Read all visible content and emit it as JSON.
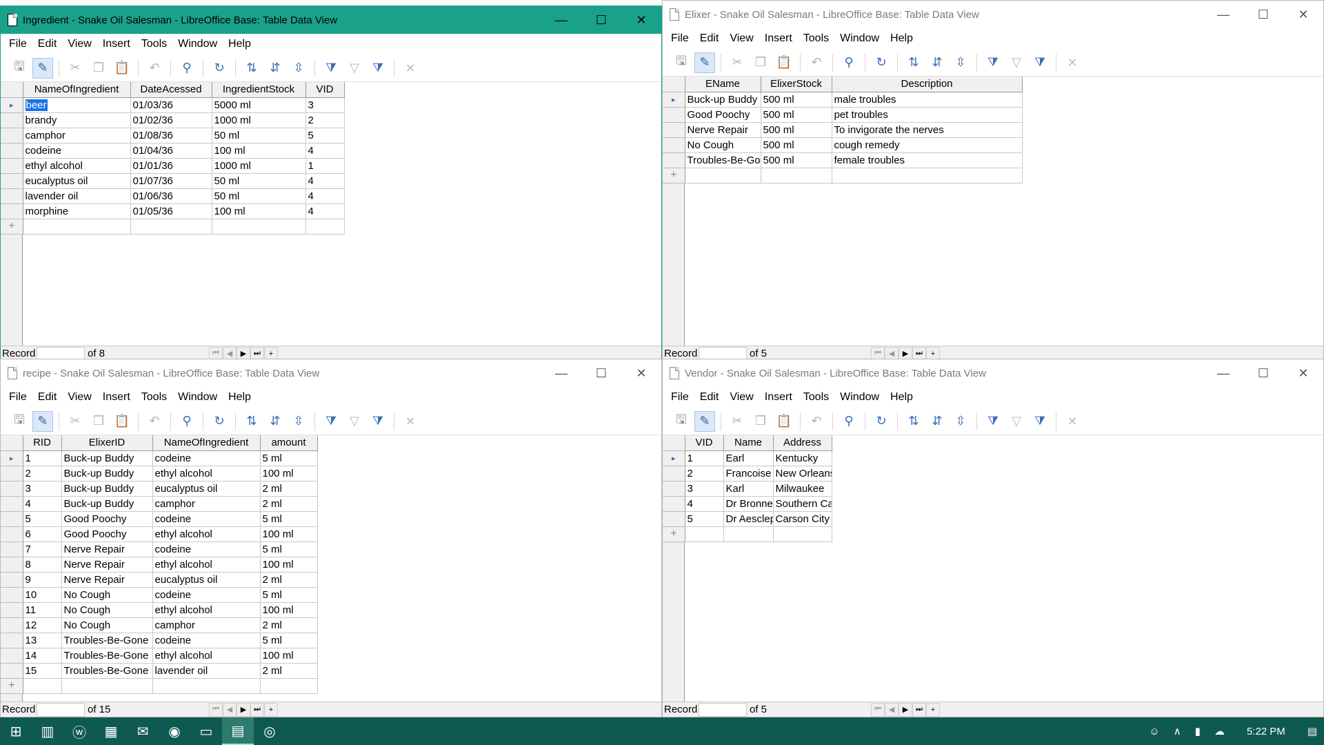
{
  "windows": {
    "ingredient": {
      "title": "Ingredient - Snake Oil Salesman - LibreOffice Base: Table Data View",
      "columns": [
        "NameOfIngredient",
        "DateAcessed",
        "IngredientStock",
        "VID"
      ],
      "rows": [
        [
          "beer",
          "01/03/36",
          "5000 ml",
          "3"
        ],
        [
          "brandy",
          "01/02/36",
          "1000 ml",
          "2"
        ],
        [
          "camphor",
          "01/08/36",
          "50 ml",
          "5"
        ],
        [
          "codeine",
          "01/04/36",
          "100 ml",
          "4"
        ],
        [
          "ethyl alcohol",
          "01/01/36",
          "1000 ml",
          "1"
        ],
        [
          "eucalyptus oil",
          "01/07/36",
          "50 ml",
          "4"
        ],
        [
          "lavender oil",
          "01/06/36",
          "50 ml",
          "4"
        ],
        [
          "morphine",
          "01/05/36",
          "100 ml",
          "4"
        ]
      ],
      "record_label": "Record",
      "record_of": "of 8"
    },
    "elixer": {
      "title": "Elixer - Snake Oil Salesman - LibreOffice Base: Table Data View",
      "columns": [
        "EName",
        "ElixerStock",
        "Description"
      ],
      "rows": [
        [
          "Buck-up Buddy",
          "500 ml",
          "male troubles"
        ],
        [
          "Good Poochy",
          "500 ml",
          "pet troubles"
        ],
        [
          "Nerve Repair",
          "500 ml",
          "To invigorate the nerves"
        ],
        [
          "No Cough",
          "500 ml",
          "cough remedy"
        ],
        [
          "Troubles-Be-Go",
          "500 ml",
          "female troubles"
        ]
      ],
      "record_label": "Record",
      "record_of": "of 5"
    },
    "recipe": {
      "title": "recipe - Snake Oil Salesman - LibreOffice Base: Table Data View",
      "columns": [
        "RID",
        "ElixerID",
        "NameOfIngredient",
        "amount"
      ],
      "rows": [
        [
          "1",
          "Buck-up Buddy",
          "codeine",
          "5 ml"
        ],
        [
          "2",
          "Buck-up Buddy",
          "ethyl alcohol",
          "100 ml"
        ],
        [
          "3",
          "Buck-up Buddy",
          "eucalyptus oil",
          "2 ml"
        ],
        [
          "4",
          "Buck-up Buddy",
          "camphor",
          "2 ml"
        ],
        [
          "5",
          "Good Poochy",
          "codeine",
          "5 ml"
        ],
        [
          "6",
          "Good Poochy",
          "ethyl alcohol",
          "100 ml"
        ],
        [
          "7",
          "Nerve Repair",
          "codeine",
          "5 ml"
        ],
        [
          "8",
          "Nerve Repair",
          "ethyl alcohol",
          "100 ml"
        ],
        [
          "9",
          "Nerve Repair",
          "eucalyptus oil",
          "2 ml"
        ],
        [
          "10",
          "No Cough",
          "codeine",
          "5 ml"
        ],
        [
          "11",
          "No Cough",
          "ethyl alcohol",
          "100 ml"
        ],
        [
          "12",
          "No Cough",
          "camphor",
          "2 ml"
        ],
        [
          "13",
          "Troubles-Be-Gone",
          "codeine",
          "5 ml"
        ],
        [
          "14",
          "Troubles-Be-Gone",
          "ethyl alcohol",
          "100 ml"
        ],
        [
          "15",
          "Troubles-Be-Gone",
          "lavender oil",
          "2 ml"
        ]
      ],
      "record_label": "Record",
      "record_of": "of 15"
    },
    "vendor": {
      "title": "Vendor - Snake Oil Salesman - LibreOffice Base: Table Data View",
      "columns": [
        "VID",
        "Name",
        "Address"
      ],
      "rows": [
        [
          "1",
          "Earl",
          "Kentucky"
        ],
        [
          "2",
          "Francoise",
          "New Orleans"
        ],
        [
          "3",
          "Karl",
          "Milwaukee"
        ],
        [
          "4",
          "Dr Bronne",
          "Southern Ca"
        ],
        [
          "5",
          "Dr Aesclep",
          "Carson City"
        ]
      ],
      "record_label": "Record",
      "record_of": "of 5"
    }
  },
  "menus": [
    "File",
    "Edit",
    "View",
    "Insert",
    "Tools",
    "Window",
    "Help"
  ],
  "taskbar": {
    "clock": "5:22 PM",
    "accent": "#0f5a50"
  },
  "colors": {
    "active_title": "#1aa189",
    "selection": "#1a73e8"
  }
}
